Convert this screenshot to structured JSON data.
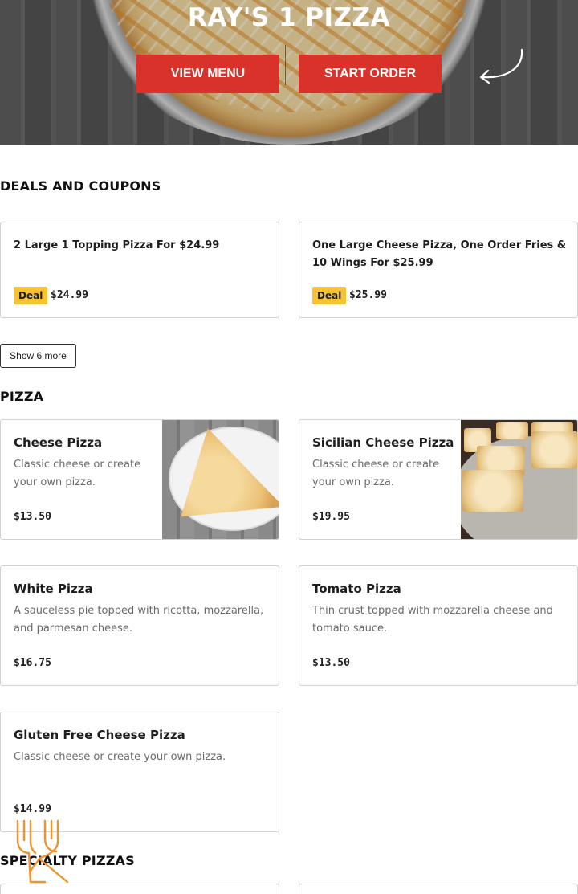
{
  "hero": {
    "title": "RAY'S 1 PIZZA",
    "view_menu_label": "VIEW MENU",
    "start_order_label": "START ORDER"
  },
  "deals": {
    "heading": "DEALS AND COUPONS",
    "items": [
      {
        "name": "2 Large 1 Topping Pizza For $24.99",
        "badge": "Deal",
        "price": "$24.99"
      },
      {
        "name": "One Large Cheese Pizza, One Order Fries & 10 Wings For $25.99",
        "badge": "Deal",
        "price": "$25.99"
      }
    ],
    "show_more_label": "Show 6 more"
  },
  "pizza": {
    "heading": "PIZZA",
    "items": [
      {
        "name": "Cheese Pizza",
        "description": "Classic cheese or create your own pizza.",
        "price": "$13.50"
      },
      {
        "name": "Sicilian Cheese Pizza",
        "description": "Classic cheese or create your own pizza.",
        "price": "$19.95"
      },
      {
        "name": "White Pizza",
        "description": "A sauceless pie topped with ricotta, mozzarella, and parmesan cheese.",
        "price": "$16.75"
      },
      {
        "name": "Tomato Pizza",
        "description": "Thin crust topped with mozzarella cheese and tomato sauce.",
        "price": "$13.50"
      },
      {
        "name": "Gluten Free Cheese Pizza",
        "description": "Classic cheese or create your own pizza.",
        "price": "$14.99"
      }
    ]
  },
  "specialty": {
    "heading": "SPECIALTY PIZZAS"
  },
  "colors": {
    "accent": "#d8322a",
    "badge": "#f7c333",
    "icon_orange": "#f0932b"
  },
  "icons": {
    "hero_arrow": "curved-arrow-icon",
    "floating": "fork-knife-icon"
  }
}
